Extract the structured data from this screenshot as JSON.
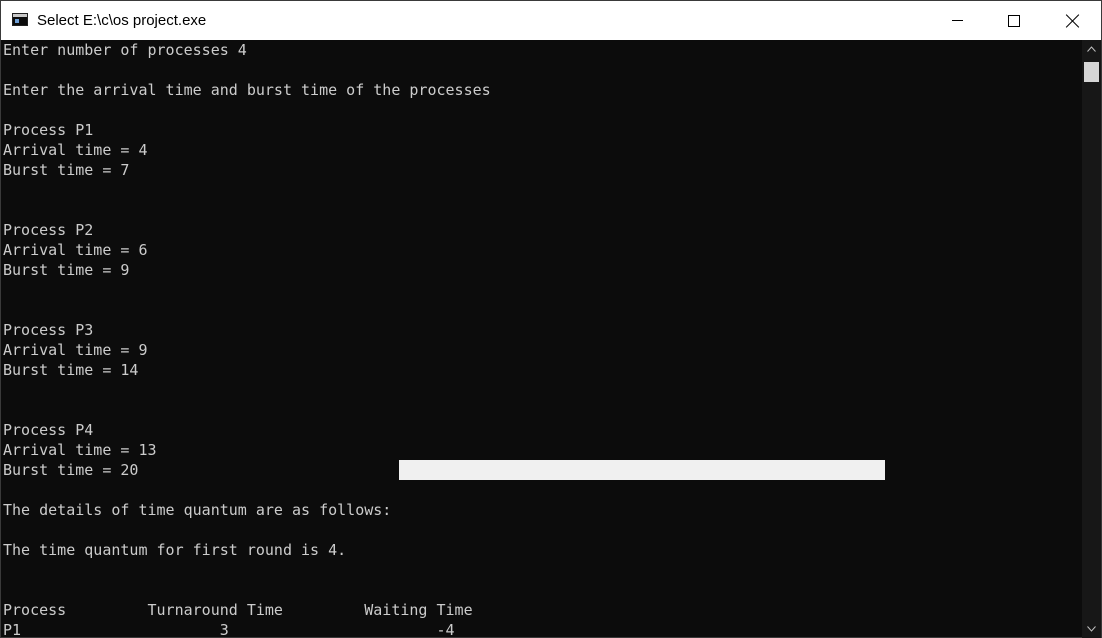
{
  "window": {
    "title": "Select E:\\c\\os project.exe",
    "icon": "console-app-icon",
    "controls": {
      "minimize": "minimize-icon",
      "maximize": "maximize-icon",
      "close": "close-icon"
    }
  },
  "console": {
    "lines": [
      "Enter number of processes 4",
      "",
      "Enter the arrival time and burst time of the processes",
      "",
      "Process P1",
      "Arrival time = 4",
      "Burst time = 7",
      "",
      "",
      "Process P2",
      "Arrival time = 6",
      "Burst time = 9",
      "",
      "",
      "Process P3",
      "Arrival time = 9",
      "Burst time = 14",
      "",
      "",
      "Process P4",
      "Arrival time = 13",
      "Burst time = 20",
      "",
      "The details of time quantum are as follows:",
      "",
      "The time quantum for first round is 4.",
      "",
      "",
      "Process         Turnaround Time         Waiting Time",
      "P1                      3                       -4"
    ]
  },
  "colors": {
    "console_background": "#0c0c0c",
    "console_text": "#cccccc",
    "selection": "#f0f0f0",
    "titlebar": "#ffffff"
  }
}
